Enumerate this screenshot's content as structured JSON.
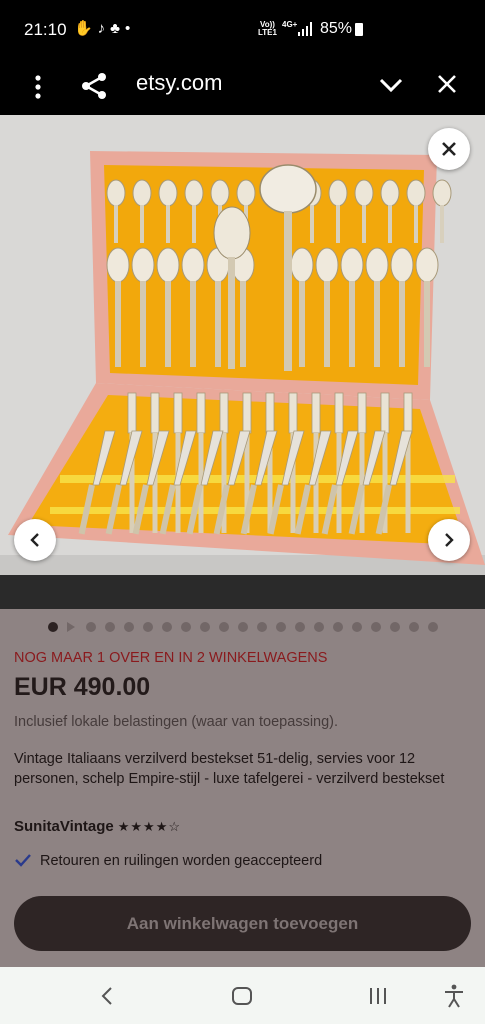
{
  "status_bar": {
    "time": "21:10",
    "network_top": "Vo))",
    "network_mid": "4G+",
    "network_bottom": "LTE1",
    "battery_pct": "85%"
  },
  "browser": {
    "domain": "etsy.com"
  },
  "product": {
    "stock_notice": "NOG MAAR 1 OVER EN IN 2 WINKELWAGENS",
    "price": "EUR 490.00",
    "tax_note": "Inclusief lokale belastingen (waar van toepassing).",
    "title": "Vintage Italiaans verzilverd bestekset 51-delig, servies voor 12 personen, schelp Empire-stijl - luxe tafelgerei - verzilverd bestekset",
    "shop_name": "SunitaVintage",
    "rating_stars": "★★★★☆",
    "rating": 4,
    "returns_text": "Retouren en ruilingen worden geaccepteerd",
    "cart_button": "Aan winkelwagen toevoegen"
  },
  "gallery": {
    "image_count": 21,
    "active_index": 0
  },
  "colors": {
    "dim_overlay": "#8e8383",
    "stock_red": "#8a1a1d",
    "button_bg": "#2e2525",
    "box_gold": "#f2a80c",
    "box_pink": "#e9a99a"
  },
  "icons": {
    "menu": "more-vert-icon",
    "share": "share-icon",
    "collapse": "chevron-down-icon",
    "close": "close-icon",
    "prev": "chevron-left-icon",
    "next": "chevron-right-icon",
    "back": "back-icon",
    "home": "home-icon",
    "recents": "recents-icon",
    "accessibility": "accessibility-icon"
  }
}
